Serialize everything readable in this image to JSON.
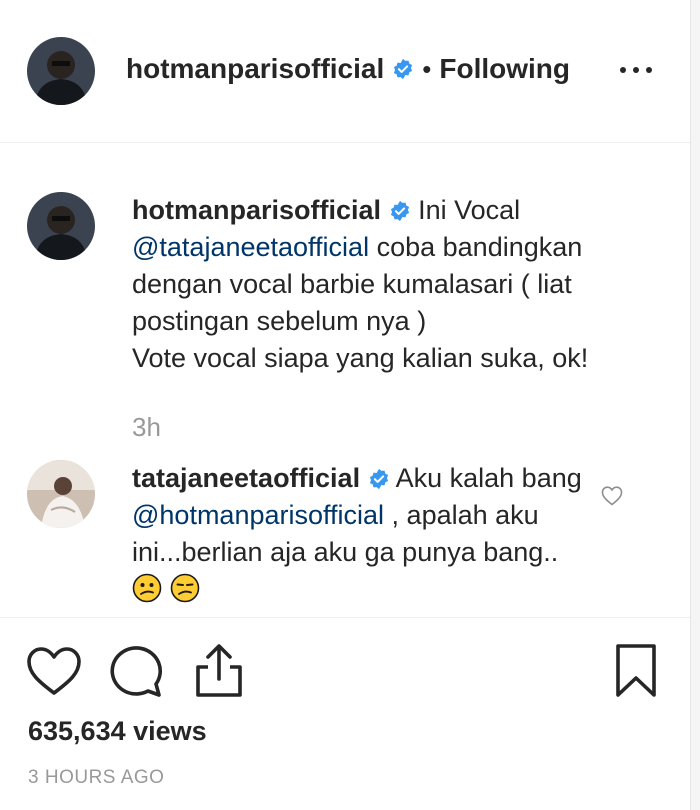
{
  "header": {
    "username": "hotmanparisofficial",
    "separator": "•",
    "follow_state": "Following",
    "more_icon": "more-horizontal-icon"
  },
  "comments": [
    {
      "username": "hotmanparisofficial",
      "verified": true,
      "text_before": "Ini Vocal",
      "mention": "@tatajaneetaofficial",
      "text_after": "coba bandingkan dengan vocal barbie kumalasari ( liat postingan sebelum nya )",
      "text_line2": "Vote vocal siapa yang kalian suka, ok!",
      "time": "3h"
    },
    {
      "username": "tatajaneetaofficial",
      "verified": true,
      "text_before": "Aku kalah bang",
      "mention": "@hotmanparisofficial",
      "text_after": ", apalah aku ini...berlian aja aku ga punya bang..",
      "emojis": [
        "confused-face",
        "confused-face"
      ]
    }
  ],
  "actions": {
    "like_icon": "heart-icon",
    "comment_icon": "comment-icon",
    "share_icon": "share-icon",
    "save_icon": "bookmark-icon"
  },
  "views": "635,634 views",
  "posted": "3 HOURS AGO",
  "colors": {
    "text": "#262626",
    "mention": "#003569",
    "muted": "#999999",
    "verified": "#3897f0"
  }
}
